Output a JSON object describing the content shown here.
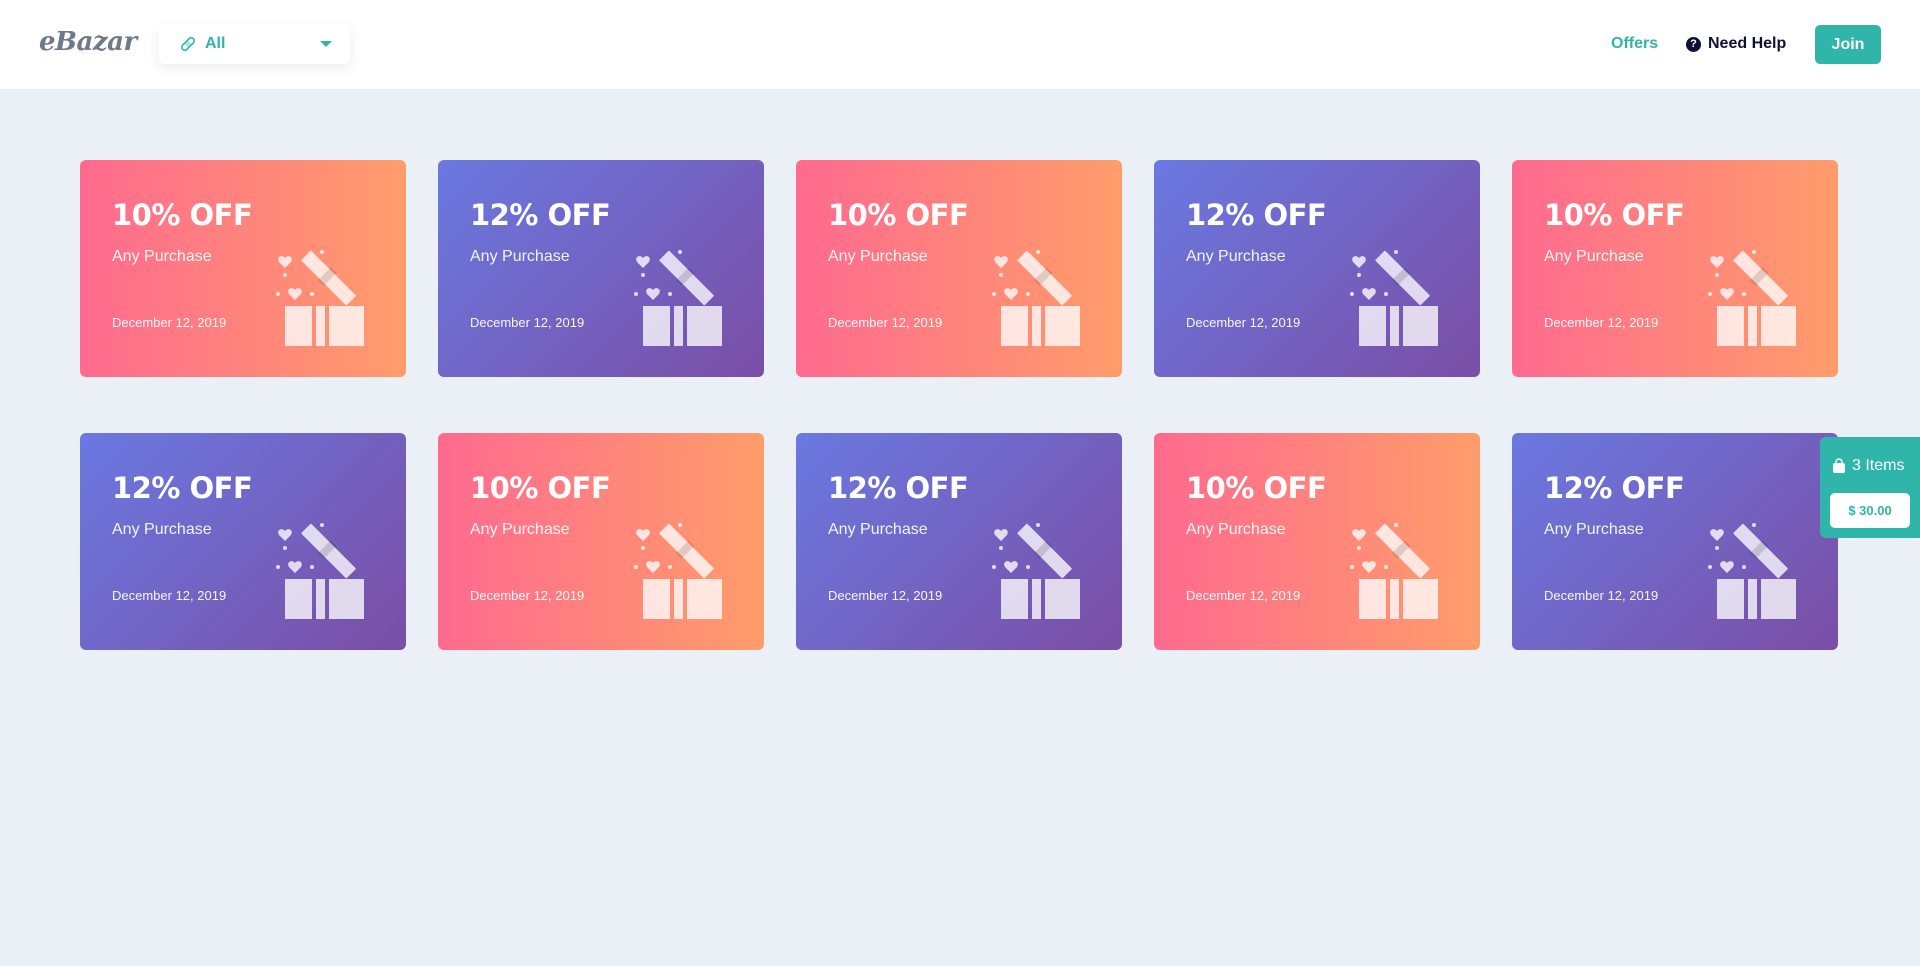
{
  "header": {
    "logo": "eBazar",
    "category_select": {
      "selected": "All",
      "icon": "bandage-icon"
    },
    "nav": {
      "offers": "Offers",
      "help": "Need Help",
      "join": "Join"
    }
  },
  "colors": {
    "accent": "#2fb5a9",
    "pink_start": "#ff6a8f",
    "pink_end": "#ff9d6a",
    "purple_start": "#6a79e1",
    "purple_end": "#7a4ea5"
  },
  "offers": [
    {
      "discount": "10% OFF",
      "description": "Any Purchase",
      "date": "December 12, 2019",
      "theme": "pink"
    },
    {
      "discount": "12% OFF",
      "description": "Any Purchase",
      "date": "December 12, 2019",
      "theme": "purple"
    },
    {
      "discount": "10% OFF",
      "description": "Any Purchase",
      "date": "December 12, 2019",
      "theme": "pink"
    },
    {
      "discount": "12% OFF",
      "description": "Any Purchase",
      "date": "December 12, 2019",
      "theme": "purple"
    },
    {
      "discount": "10% OFF",
      "description": "Any Purchase",
      "date": "December 12, 2019",
      "theme": "pink"
    },
    {
      "discount": "12% OFF",
      "description": "Any Purchase",
      "date": "December 12, 2019",
      "theme": "purple"
    },
    {
      "discount": "10% OFF",
      "description": "Any Purchase",
      "date": "December 12, 2019",
      "theme": "pink"
    },
    {
      "discount": "12% OFF",
      "description": "Any Purchase",
      "date": "December 12, 2019",
      "theme": "purple"
    },
    {
      "discount": "10% OFF",
      "description": "Any Purchase",
      "date": "December 12, 2019",
      "theme": "pink"
    },
    {
      "discount": "12% OFF",
      "description": "Any Purchase",
      "date": "December 12, 2019",
      "theme": "purple"
    }
  ],
  "cart": {
    "items_label": "3 Items",
    "total": "$ 30.00"
  }
}
